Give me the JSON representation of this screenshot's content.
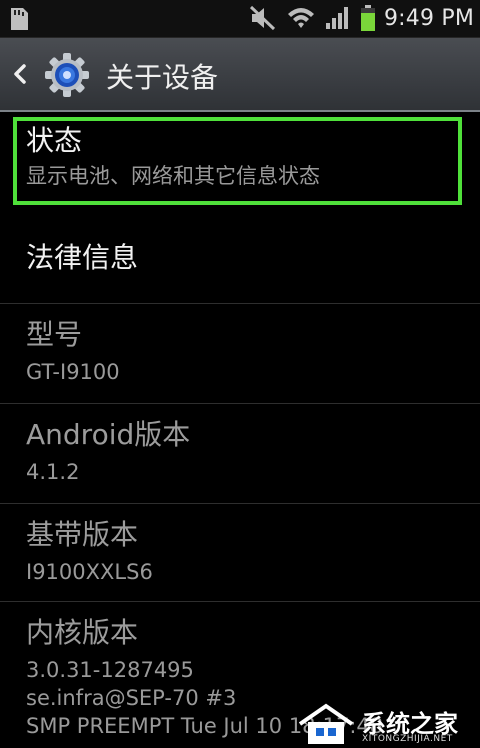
{
  "status_bar": {
    "time": "9:49 PM",
    "icons": [
      "sd-card-icon",
      "mute-icon",
      "wifi-icon",
      "signal-icon",
      "battery-icon"
    ]
  },
  "action_bar": {
    "title": "关于设备"
  },
  "items": [
    {
      "title": "状态",
      "subtitle": "显示电池、网络和其它信息状态"
    },
    {
      "title": "法律信息"
    },
    {
      "title": "型号",
      "subtitle": "GT-I9100"
    },
    {
      "title": "Android版本",
      "subtitle": "4.1.2"
    },
    {
      "title": "基带版本",
      "subtitle": "I9100XXLS6"
    },
    {
      "title": "内核版本",
      "subtitle_lines": [
        "3.0.31-1287495",
        "se.infra@SEP-70 #3",
        "SMP PREEMPT Tue Jul 10 18:17:48"
      ]
    }
  ],
  "watermark": {
    "text": "系统之家",
    "subtext": "XITONGZHIJIA.NET"
  },
  "colors": {
    "highlight": "#4fe03a",
    "background": "#000000",
    "battery": "#7ad63a"
  }
}
